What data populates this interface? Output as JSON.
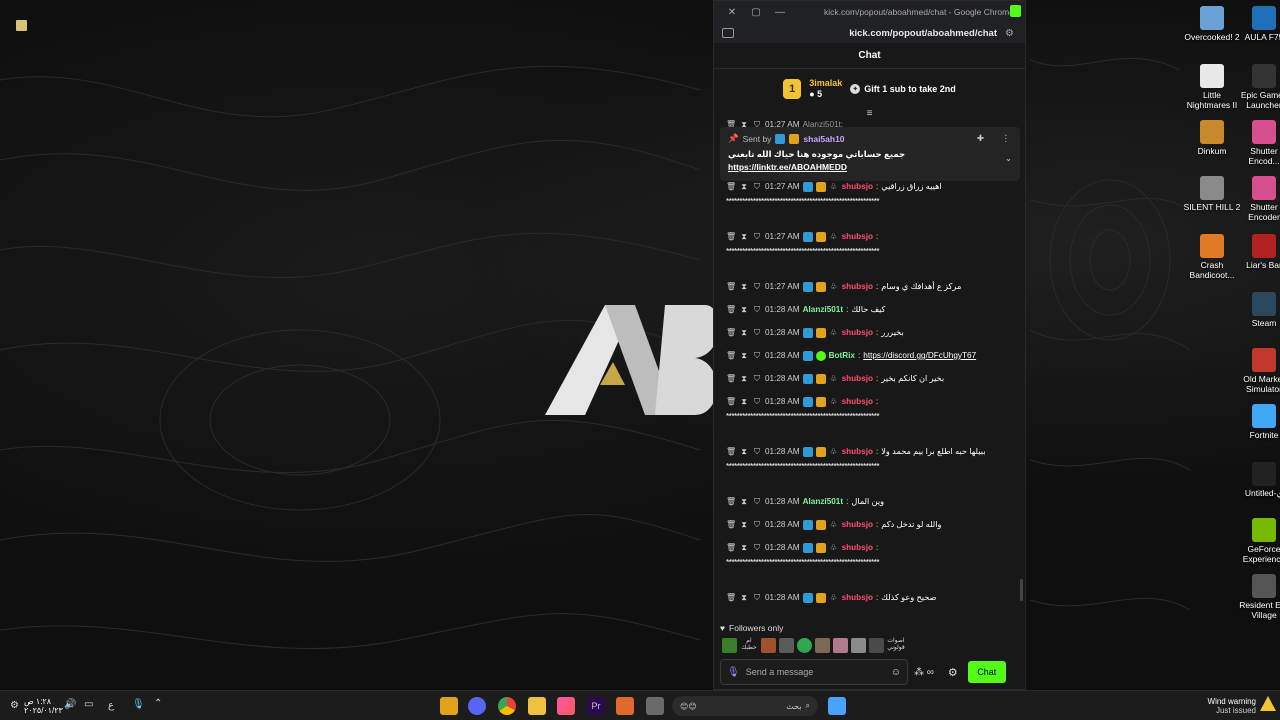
{
  "window": {
    "title": "kick.com/popout/aboahmed/chat - Google Chrome",
    "url": "kick.com/popout/aboahmed/chat"
  },
  "chat": {
    "header": "Chat",
    "leaderboard": {
      "rank": "1",
      "user": "3imalak",
      "count": "5",
      "gift_text": "Gift 1 sub to take 2nd"
    },
    "pinned": {
      "sent_by_label": "Sent by",
      "sender": "shai5ah10",
      "message": "جميع حساباتي موجوده هنا حياك الله تابعني",
      "link": "https://linktr.ee/ABOAHMEDD"
    },
    "messages": [
      {
        "time": "01:27 AM",
        "user": "Alanzi501t:",
        "style": "dark",
        "text": "",
        "partial": true
      },
      {
        "time": "01:27 AM",
        "user": "shubsjo",
        "style": "red",
        "text": "اهييه زراق زراقيي",
        "wrap": "*********************************************************"
      },
      {
        "time": "01:27 AM",
        "user": "shubsjo",
        "style": "red",
        "text": "",
        "wrap": "*********************************************************"
      },
      {
        "time": "01:27 AM",
        "user": "shubsjo",
        "style": "red",
        "text": "مركز ع أهدافك ي وسام"
      },
      {
        "time": "01:28 AM",
        "user": "Alanzi501t",
        "style": "green",
        "text": "كيف حالك"
      },
      {
        "time": "01:28 AM",
        "user": "shubsjo",
        "style": "red",
        "text": "بخيررر"
      },
      {
        "time": "01:28 AM",
        "user": "BotRix",
        "style": "green",
        "text": "",
        "link": "https://discord.gg/DFcUhgyT67"
      },
      {
        "time": "01:28 AM",
        "user": "shubsjo",
        "style": "red",
        "text": "بخير ان كانكم بخير"
      },
      {
        "time": "01:28 AM",
        "user": "shubsjo",
        "style": "red",
        "text": "",
        "wrap": "*********************************************************"
      },
      {
        "time": "01:28 AM",
        "user": "shubsjo",
        "style": "red",
        "text": "ببيلها حبه اطلع برا بيم محمد ولا",
        "wrap": "*********************************************************"
      },
      {
        "time": "01:28 AM",
        "user": "Alanzi501t",
        "style": "green",
        "text": "وين المال"
      },
      {
        "time": "01:28 AM",
        "user": "shubsjo",
        "style": "red",
        "text": "والله لو تدخل دكم"
      },
      {
        "time": "01:28 AM",
        "user": "shubsjo",
        "style": "red",
        "text": "",
        "wrap": "*********************************************************"
      },
      {
        "time": "01:28 AM",
        "user": "shubsjo",
        "style": "red",
        "text": "صحيح وعو كذلك"
      }
    ],
    "followers_only": "Followers only",
    "emote_label": "اصوات قولوني",
    "emote_label2": "ام خطبك",
    "input_placeholder": "Send a message",
    "send_label": "Chat"
  },
  "desktop_icons": [
    {
      "label": "Overcooked! 2",
      "color": "#6aa2d8"
    },
    {
      "label": "AULA F75",
      "color": "#1f6fb8"
    },
    {
      "label": "Little Nightmares II",
      "color": "#e8e8e8"
    },
    {
      "label": "Epic Games Launcher",
      "color": "#333333"
    },
    {
      "label": "Dinkum",
      "color": "#c98a2e"
    },
    {
      "label": "Shutter Encod...",
      "color": "#d64f8c"
    },
    {
      "label": "SILENT HILL 2",
      "color": "#8a8a8a"
    },
    {
      "label": "Shutter Encoder",
      "color": "#d64f8c"
    },
    {
      "label": "Crash Bandicoot...",
      "color": "#e07b23"
    },
    {
      "label": "Liar's Bar",
      "color": "#b22222"
    },
    {
      "label": "Steam",
      "color": "#2a475e"
    },
    {
      "label": "Old Market Simulator",
      "color": "#c0392b"
    },
    {
      "label": "Fortnite",
      "color": "#3fa9f5"
    },
    {
      "label": "Untitled-ي",
      "color": "#222222"
    },
    {
      "label": "GeForce Experience",
      "color": "#76b900"
    },
    {
      "label": "Resident Evil Village",
      "color": "#555555"
    }
  ],
  "taskbar": {
    "clock_time": "١:٢٨ ص",
    "clock_date": "٢٠٢٥/٠١/٢٣",
    "lang": "ع",
    "search_placeholder": "بحث",
    "notification_title": "Wind warning",
    "notification_sub": "Just issued"
  }
}
